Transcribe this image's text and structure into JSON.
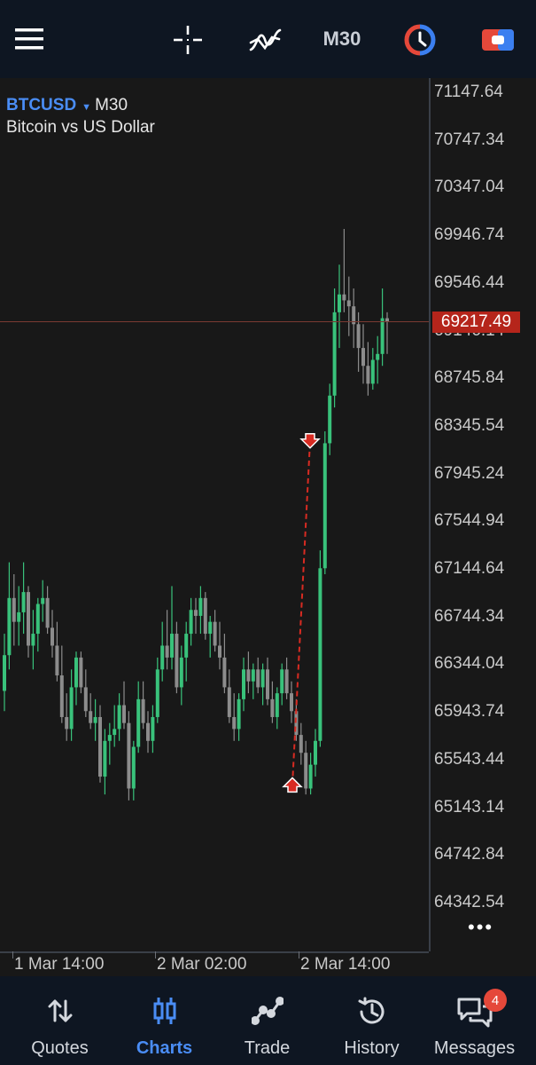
{
  "toolbar": {
    "menu_icon": "hamburger-menu-icon",
    "crosshair_icon": "crosshair-icon",
    "indicators_icon": "indicators-icon",
    "timeframe": "M30",
    "quick_trade_icon": "one-click-trading-icon",
    "trade_panel_icon": "trade-panel-icon"
  },
  "chart": {
    "symbol": "BTCUSD",
    "timeframe": "M30",
    "description": "Bitcoin vs US Dollar",
    "current_price": "69217.49",
    "colors": {
      "bull": "#39c27b",
      "bear": "#8c8c8c",
      "price_line": "#b5251b",
      "trade_arrow": "#d82b22",
      "background": "#181818"
    },
    "more_label": "•••"
  },
  "chart_data": {
    "type": "candlestick",
    "symbol": "BTCUSD",
    "timeframe": "M30",
    "price_axis_labels": [
      "71147.64",
      "70747.34",
      "70347.04",
      "69946.74",
      "69546.44",
      "69146.14",
      "68745.84",
      "68345.54",
      "67945.24",
      "67544.94",
      "67144.64",
      "66744.34",
      "66344.04",
      "65943.74",
      "65543.44",
      "65143.14",
      "64742.84",
      "64342.54"
    ],
    "time_axis_labels": [
      "1 Mar 14:00",
      "2 Mar 02:00",
      "2 Mar 14:00"
    ],
    "current_price": 69217.49,
    "trades": [
      {
        "direction": "buy",
        "price": 65330
      },
      {
        "direction": "sell",
        "price": 68220
      }
    ],
    "candles": [
      [
        66120,
        66600,
        65950,
        66420
      ],
      [
        66420,
        67200,
        66300,
        66900
      ],
      [
        66900,
        67100,
        66500,
        66700
      ],
      [
        66700,
        67000,
        66500,
        66780
      ],
      [
        66780,
        67200,
        66600,
        66950
      ],
      [
        66950,
        67000,
        66400,
        66500
      ],
      [
        66500,
        66800,
        66300,
        66600
      ],
      [
        66600,
        66900,
        66450,
        66850
      ],
      [
        66850,
        67050,
        66700,
        66900
      ],
      [
        66900,
        67000,
        66600,
        66650
      ],
      [
        66650,
        66800,
        66400,
        66500
      ],
      [
        66500,
        66700,
        66200,
        66250
      ],
      [
        66250,
        66500,
        65850,
        65900
      ],
      [
        65900,
        66100,
        65700,
        65800
      ],
      [
        65800,
        66300,
        65700,
        66150
      ],
      [
        66150,
        66450,
        66000,
        66400
      ],
      [
        66400,
        66450,
        66100,
        66150
      ],
      [
        66150,
        66300,
        65900,
        65950
      ],
      [
        65950,
        66100,
        65800,
        65850
      ],
      [
        65850,
        66050,
        65700,
        65900
      ],
      [
        65900,
        66000,
        65350,
        65400
      ],
      [
        65400,
        65800,
        65250,
        65700
      ],
      [
        65700,
        65850,
        65500,
        65750
      ],
      [
        65750,
        66000,
        65650,
        65800
      ],
      [
        65800,
        66100,
        65700,
        66000
      ],
      [
        66000,
        66200,
        65800,
        65850
      ],
      [
        65850,
        65950,
        65200,
        65300
      ],
      [
        65300,
        65700,
        65200,
        65650
      ],
      [
        65650,
        66200,
        65600,
        66050
      ],
      [
        66050,
        66200,
        65800,
        65850
      ],
      [
        65850,
        65950,
        65600,
        65700
      ],
      [
        65700,
        66000,
        65600,
        65900
      ],
      [
        65900,
        66400,
        65850,
        66300
      ],
      [
        66300,
        66700,
        66200,
        66500
      ],
      [
        66500,
        66800,
        66300,
        66400
      ],
      [
        66400,
        67000,
        66300,
        66600
      ],
      [
        66600,
        66700,
        66100,
        66150
      ],
      [
        66150,
        66500,
        66000,
        66400
      ],
      [
        66400,
        66700,
        66200,
        66600
      ],
      [
        66600,
        66900,
        66500,
        66800
      ],
      [
        66800,
        66900,
        66600,
        66750
      ],
      [
        66750,
        67000,
        66600,
        66900
      ],
      [
        66900,
        66950,
        66550,
        66600
      ],
      [
        66600,
        66750,
        66400,
        66700
      ],
      [
        66700,
        66800,
        66450,
        66500
      ],
      [
        66500,
        66700,
        66300,
        66400
      ],
      [
        66400,
        66600,
        66100,
        66150
      ],
      [
        66150,
        66300,
        65850,
        65900
      ],
      [
        65900,
        66100,
        65700,
        65800
      ],
      [
        65800,
        66100,
        65700,
        66050
      ],
      [
        66050,
        66400,
        65950,
        66300
      ],
      [
        66300,
        66450,
        66100,
        66200
      ],
      [
        66200,
        66350,
        66050,
        66300
      ],
      [
        66300,
        66400,
        66100,
        66150
      ],
      [
        66150,
        66350,
        66000,
        66300
      ],
      [
        66300,
        66400,
        66000,
        66050
      ],
      [
        66050,
        66200,
        65850,
        65900
      ],
      [
        65900,
        66150,
        65800,
        66100
      ],
      [
        66100,
        66350,
        66000,
        66300
      ],
      [
        66300,
        66400,
        66050,
        66100
      ],
      [
        66100,
        66200,
        65850,
        65950
      ],
      [
        65950,
        66050,
        65700,
        65750
      ],
      [
        65750,
        65850,
        65500,
        65600
      ],
      [
        65600,
        65700,
        65250,
        65300
      ],
      [
        65300,
        65600,
        65250,
        65500
      ],
      [
        65500,
        65800,
        65400,
        65700
      ],
      [
        65700,
        67300,
        65650,
        67150
      ],
      [
        67150,
        68300,
        67100,
        68200
      ],
      [
        68200,
        68700,
        68100,
        68600
      ],
      [
        68600,
        69500,
        68500,
        69300
      ],
      [
        69300,
        69700,
        69000,
        69450
      ],
      [
        69450,
        70000,
        69300,
        69400
      ],
      [
        69400,
        69600,
        69100,
        69350
      ],
      [
        69350,
        69500,
        69000,
        69200
      ],
      [
        69200,
        69300,
        68800,
        69000
      ],
      [
        69000,
        69200,
        68700,
        68850
      ],
      [
        68850,
        69050,
        68600,
        68700
      ],
      [
        68700,
        69000,
        68650,
        68900
      ],
      [
        68900,
        69100,
        68700,
        68950
      ],
      [
        68950,
        69500,
        68850,
        69250
      ],
      [
        69250,
        69300,
        68950,
        69217
      ]
    ]
  },
  "time_labels": [
    "1 Mar 14:00",
    "2 Mar 02:00",
    "2 Mar 14:00"
  ],
  "price_labels": [
    "71147.64",
    "70747.34",
    "70347.04",
    "69946.74",
    "69546.44",
    "69146.14",
    "68745.84",
    "68345.54",
    "67945.24",
    "67544.94",
    "67144.64",
    "66744.34",
    "66344.04",
    "65943.74",
    "65543.44",
    "65143.14",
    "64742.84",
    "64342.54"
  ],
  "nav": {
    "items": [
      {
        "label": "Quotes",
        "icon": "quotes-arrows-icon",
        "active": false
      },
      {
        "label": "Charts",
        "icon": "candlestick-chart-icon",
        "active": true
      },
      {
        "label": "Trade",
        "icon": "trade-line-icon",
        "active": false
      },
      {
        "label": "History",
        "icon": "history-clock-icon",
        "active": false
      },
      {
        "label": "Messages",
        "icon": "messages-chat-icon",
        "active": false
      }
    ],
    "messages_badge": "4"
  }
}
